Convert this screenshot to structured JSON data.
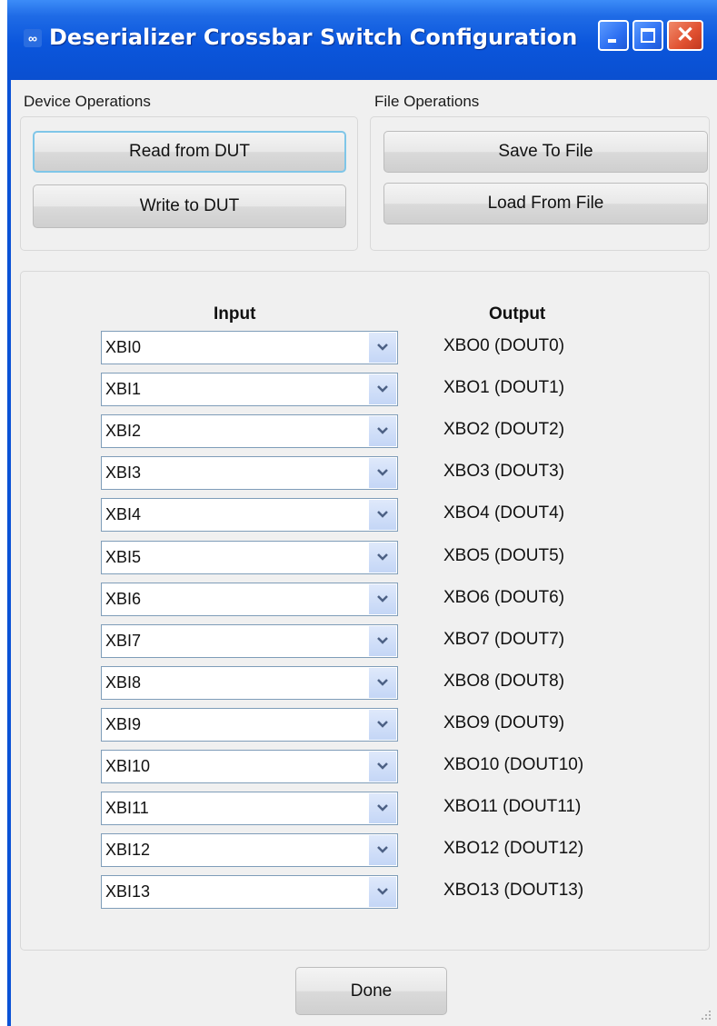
{
  "window": {
    "title": "Deserializer Crossbar Switch Configuration",
    "app_icon_glyph": "∞",
    "close_glyph": "✕"
  },
  "device_ops": {
    "label": "Device Operations",
    "read_button": "Read from DUT",
    "write_button": "Write to DUT"
  },
  "file_ops": {
    "label": "File Operations",
    "save_button": "Save To File",
    "load_button": "Load From File"
  },
  "mapping": {
    "input_header": "Input",
    "output_header": "Output",
    "rows": [
      {
        "input": "XBI0",
        "output": "XBO0 (DOUT0)"
      },
      {
        "input": "XBI1",
        "output": "XBO1 (DOUT1)"
      },
      {
        "input": "XBI2",
        "output": "XBO2 (DOUT2)"
      },
      {
        "input": "XBI3",
        "output": "XBO3  (DOUT3)"
      },
      {
        "input": "XBI4",
        "output": "XBO4  (DOUT4)"
      },
      {
        "input": "XBI5",
        "output": "XBO5  (DOUT5)"
      },
      {
        "input": "XBI6",
        "output": "XBO6  (DOUT6)"
      },
      {
        "input": "XBI7",
        "output": "XBO7  (DOUT7)"
      },
      {
        "input": "XBI8",
        "output": "XBO8  (DOUT8)"
      },
      {
        "input": "XBI9",
        "output": "XBO9  (DOUT9)"
      },
      {
        "input": "XBI10",
        "output": "XBO10  (DOUT10)"
      },
      {
        "input": "XBI11",
        "output": "XBO11  (DOUT11)"
      },
      {
        "input": "XBI12",
        "output": "XBO12  (DOUT12)"
      },
      {
        "input": "XBI13",
        "output": "XBO13  (DOUT13)"
      }
    ]
  },
  "footer": {
    "done_button": "Done"
  },
  "colors": {
    "titlebar": "#0a52d6",
    "client_bg": "#f0f0f0",
    "combo_border": "#7f9db9",
    "focus_ring": "#7fc6e8"
  }
}
